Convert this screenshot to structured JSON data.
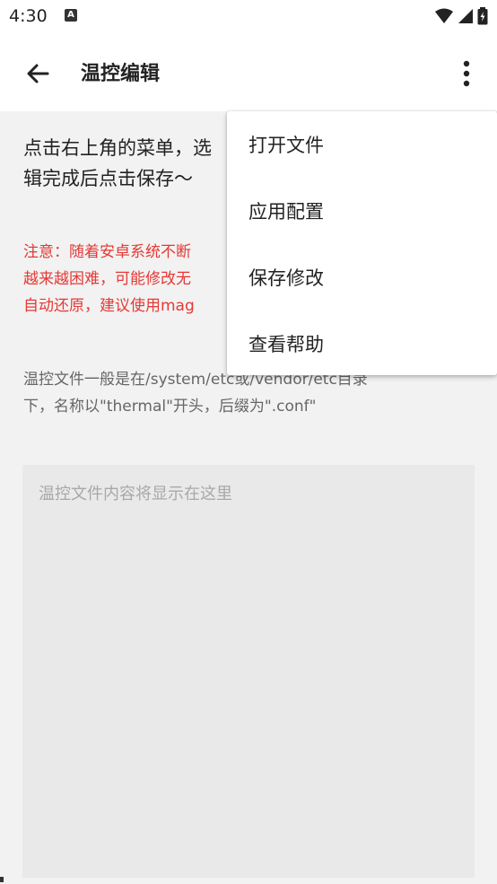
{
  "status_bar": {
    "time": "4:30",
    "notification_icon": "a-icon",
    "icons": [
      "wifi-icon",
      "signal-icon",
      "battery-icon"
    ]
  },
  "app_bar": {
    "title": "温控编辑"
  },
  "content": {
    "intro_line1": "点击右上角的菜单，选",
    "intro_line2": "辑完成后点击保存～",
    "warning_line1": "注意：随着安卓系统不断",
    "warning_line2": "越来越困难，可能修改无",
    "warning_line3": "自动还原，建议使用mag",
    "path_line1": "温控文件一般是在/system/etc或/vendor/etc目录",
    "path_line2": "下，名称以\"thermal\"开头，后缀为\".conf\"",
    "editor_placeholder": "温控文件内容将显示在这里"
  },
  "menu": {
    "items": [
      {
        "label": "打开文件"
      },
      {
        "label": "应用配置"
      },
      {
        "label": "保存修改"
      },
      {
        "label": "查看帮助"
      }
    ]
  },
  "colors": {
    "warning": "#e53935",
    "background": "#f2f2f2",
    "editor_bg": "#e9e9e9"
  }
}
